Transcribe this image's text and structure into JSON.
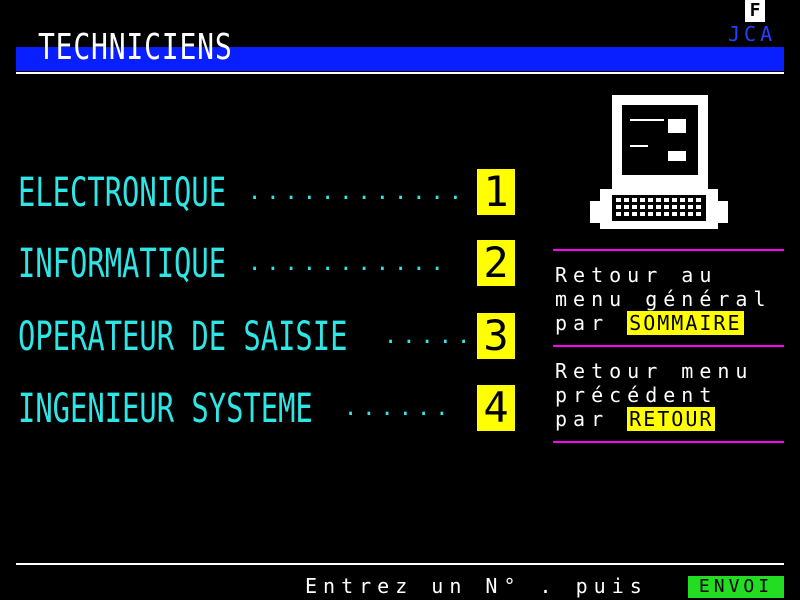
{
  "header": {
    "title": "TECHNICIENS",
    "corner_badge": "F",
    "corner_code": "JCA"
  },
  "menu": {
    "items": [
      {
        "label": "ELECTRONIQUE",
        "dots": "............",
        "number": "1"
      },
      {
        "label": "INFORMATIQUE",
        "dots": "...........",
        "number": "2"
      },
      {
        "label": "OPERATEUR DE SAISIE",
        "dots": ".....",
        "number": "3"
      },
      {
        "label": "INGENIEUR SYSTEME",
        "dots": "......",
        "number": "4"
      }
    ]
  },
  "side_panel": {
    "return_general_line1": "Retour au",
    "return_general_line2": "menu général",
    "return_general_line3_prefix": "par",
    "sommaire_key": "SOMMAIRE",
    "return_prev_line1": "Retour menu",
    "return_prev_line2": "précédent",
    "return_prev_line3_prefix": "par",
    "retour_key": "RETOUR"
  },
  "footer": {
    "prompt": "Entrez un N° . puis",
    "envoi_key": "ENVOI"
  },
  "icons": {
    "terminal": "computer-terminal-icon"
  },
  "colors": {
    "background": "#000000",
    "title_bar": "#0a1fff",
    "menu_text": "#2ee6e6",
    "number_box": "#ffff00",
    "divider": "#ff00ff",
    "envoi": "#22dd22"
  }
}
